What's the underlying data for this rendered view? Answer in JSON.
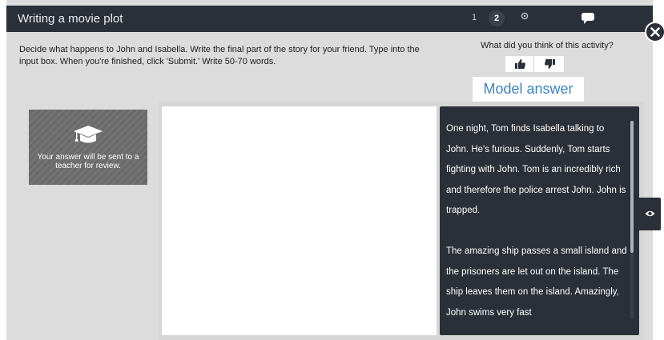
{
  "header": {
    "title": "Writing a movie plot",
    "steps": [
      "1",
      "2"
    ],
    "target_icon": "target-icon",
    "chat_icon": "speech-bubble-icon"
  },
  "close_icon": "close-icon",
  "instructions": "Decide what happens to John and Isabella. Write the final part of the story for your friend. Type into the input box. When you're finished, click 'Submit.' Write 50-70 words.",
  "feedback": {
    "question": "What did you think of this activity?",
    "like_icon": "thumbs-up-icon",
    "dislike_icon": "thumbs-down-icon"
  },
  "model_tab": "Model answer",
  "info_card": {
    "icon": "graduation-cap-icon",
    "text": "Your answer will be sent to a teacher for review."
  },
  "answer_box": {
    "value": ""
  },
  "model_answer": {
    "paragraph1": "One night, Tom finds Isabella talking to John. He's furious. Suddenly, Tom starts fighting with John. Tom is an incredibly rich and therefore the police arrest John. John is trapped.",
    "paragraph2": "The amazing ship passes a small island and the prisoners are let out on the island. The ship leaves them on the island. Amazingly, John swims very fast"
  },
  "eye_icon": "eye-icon",
  "colors": {
    "bar": "#2b2f38",
    "background": "#dcdcdc",
    "accent": "#3c85c6",
    "card": "#6b6b6b"
  }
}
